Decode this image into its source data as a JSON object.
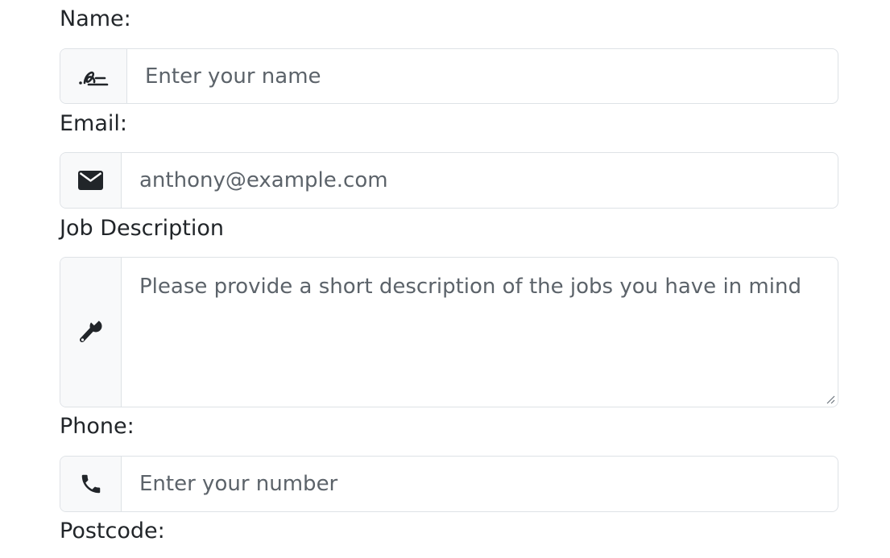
{
  "form": {
    "name": {
      "label": "Name:",
      "placeholder": "Enter your name",
      "icon": "signature-icon"
    },
    "email": {
      "label": "Email:",
      "placeholder": "anthony@example.com",
      "icon": "envelope-icon"
    },
    "job_description": {
      "label": "Job Description",
      "placeholder": "Please provide a short description of the jobs you have in mind",
      "icon": "wrench-icon"
    },
    "phone": {
      "label": "Phone:",
      "placeholder": "Enter your number",
      "icon": "phone-icon"
    },
    "postcode": {
      "label": "Postcode:"
    }
  },
  "colors": {
    "text": "#212529",
    "placeholder": "#5c636a",
    "border": "#dee2e6",
    "addon_background": "#f8f9fa"
  }
}
